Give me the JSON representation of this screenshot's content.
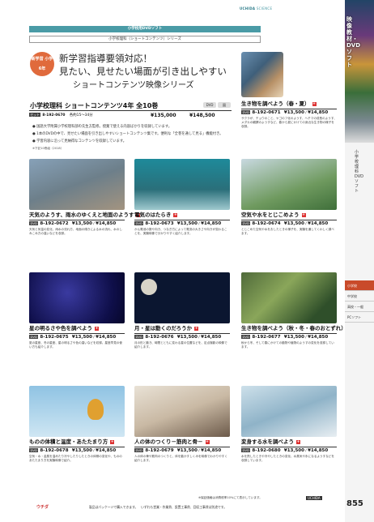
{
  "header": {
    "brand_prefix": "UCHIDA",
    "brand_suffix": "SCIENCE"
  },
  "band_label": "小学校用DVDソフト",
  "sub_band_label": "小学校理科（ショートコンテンツ）シリーズ",
  "badge": "新学習 小学6年",
  "hero": {
    "line1": "新学習指導要領対応！",
    "line2": "見たい、見せたい場面が引き出しやすい",
    "line3": "ショートコンテンツ映像シリーズ"
  },
  "series": {
    "title": "小学校理科 ショートコンテンツ4年 全10巻",
    "icons": [
      "DVD",
      "図"
    ],
    "set_label": "セット",
    "id": "8-192-0670",
    "detail": "各約15〜34分",
    "price_plain": "¥135,000",
    "price_tax": "¥148,500",
    "bullets": [
      "● 国語大学附属小学校理科部の先生方監修。授業で使える内容ばかりを収録しています。",
      "● 1本のDVDの中で、見せたい場面を引き出しやすいショートコンテンツ集です。便利な「全巻を通して見る」機能付き。",
      "● 学習内容に沿って見納得なコンテンツを収録しています。"
    ],
    "note": "※下記10巻組（2018）"
  },
  "cards": [
    {
      "title": "生き物を調べよう（春・夏）",
      "id": "8-192-0671",
      "price": "¥13,500",
      "price_tax": "¥14,850",
      "desc": "サクラが、チョウのこと、ヤゴのフ化のようす、ヘチマの成長のようす、メダカの観察のようすなど、春から夏にかけての身近な生き物の様子を収録。"
    },
    {
      "title": "天気のようす、雨水のゆくえと地面のようす",
      "id": "8-192-0672",
      "price": "¥13,500",
      "price_tax": "¥14,850",
      "desc": "天気と気温の変化、雨水の流れ方、地面の傾きによる水の流れ、水のしみこみ方の違いなどを収録。"
    },
    {
      "title": "電気のはたらき",
      "id": "8-192-0673",
      "price": "¥13,500",
      "price_tax": "¥14,850",
      "desc": "かん電池の数や向き、つなぎ方によって電流の大きさや向きが変わることを、実験映像で分かりやすく紹介します。"
    },
    {
      "title": "空気や水をとじこめよう",
      "id": "8-192-0674",
      "price": "¥13,500",
      "price_tax": "¥14,850",
      "desc": "とじこめた空気や水をおしたときの様子を、実験を通してくわしく調べます。"
    },
    {
      "title": "星の明るさや色を調べよう",
      "id": "8-192-0675",
      "price": "¥13,500",
      "price_tax": "¥14,850",
      "desc": "夏の星座、冬の星座、星の明るさや色の違いなどを収録。星座早見の使い方も紹介します。"
    },
    {
      "title": "月・星は動くのだろうか",
      "id": "8-192-0676",
      "price": "¥13,500",
      "price_tax": "¥14,850",
      "desc": "月の形と動き、時間とともに変わる星の位置などを、定点撮影の映像で紹介します。"
    },
    {
      "title": "生き物を調べよう（秋・冬・春のおとずれ）",
      "id": "8-192-0677",
      "price": "¥13,500",
      "price_tax": "¥14,850",
      "desc": "秋から冬、そして春にかけての動物や植物のようすの変化を収録しています。"
    },
    {
      "title": "ものの体積と温度・あたたまり方",
      "id": "8-192-0678",
      "price": "¥13,500",
      "price_tax": "¥14,850",
      "desc": "空気・水・金属を温めたり冷やしたりしたときの体積の変化や、もののあたたまり方を実験映像で紹介。"
    },
    {
      "title": "人の体のつくり－筋肉と骨－",
      "id": "8-192-0679",
      "price": "¥13,500",
      "price_tax": "¥14,850",
      "desc": "人の体の骨や筋肉のつくりと、体を動かすしくみを映像でわかりやすく紹介します。"
    },
    {
      "title": "変身する水を調べよう",
      "id": "8-192-0680",
      "price": "¥13,500",
      "price_tax": "¥14,850",
      "desc": "水を熱したときや冷やしたときの変化、水蒸気や氷になるようすなどを収録しています。"
    }
  ],
  "sidebar": {
    "tag": "映像教材・DVDソフト",
    "vertical": "小学校理科DVDソフト",
    "nav": [
      "小学校",
      "中学校",
      "高校・一般",
      "PCソフト"
    ]
  },
  "footer": {
    "note": "※保証価格は消費税率10%にて表示しています。",
    "logo": "ウチダ",
    "logo2": "UCHIDA",
    "text": "製品はパッケージで購入できます。　いずれも営業・作業費、設置工事費、回収工事費は別途です。",
    "page": "855"
  },
  "colors": {
    "accent": "#4a9ba6",
    "badge": "#e06a3c",
    "sidebar_active": "#c94a2a"
  }
}
